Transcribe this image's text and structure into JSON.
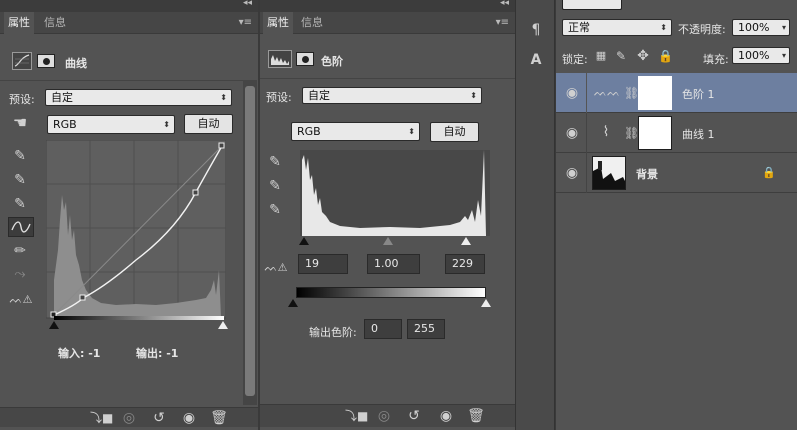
{
  "curves_panel": {
    "tabs": [
      "属性",
      "信息"
    ],
    "title": "曲线",
    "preset_label": "预设:",
    "preset_value": "自定",
    "channel_value": "RGB",
    "auto_label": "自动",
    "input_label": "输入: -1",
    "output_label": "输出: -1"
  },
  "levels_panel": {
    "tabs": [
      "属性",
      "信息"
    ],
    "title": "色阶",
    "preset_label": "预设:",
    "preset_value": "自定",
    "channel_value": "RGB",
    "auto_label": "自动",
    "black_input": "19",
    "gamma_input": "1.00",
    "white_input": "229",
    "output_label": "输出色阶:",
    "output_black": "0",
    "output_white": "255"
  },
  "layers_panel": {
    "blend_mode": "正常",
    "opacity_label": "不透明度:",
    "opacity_value": "100%",
    "lock_label": "锁定:",
    "fill_label": "填充:",
    "fill_value": "100%",
    "layers": [
      {
        "name": "色阶 1",
        "selected": true
      },
      {
        "name": "曲线 1",
        "selected": false
      },
      {
        "name": "背景",
        "selected": false
      }
    ]
  },
  "colors": {
    "panel_bg": "#535353",
    "selected_layer": "#6d7fa0",
    "histogram": "#a0a0a0"
  }
}
